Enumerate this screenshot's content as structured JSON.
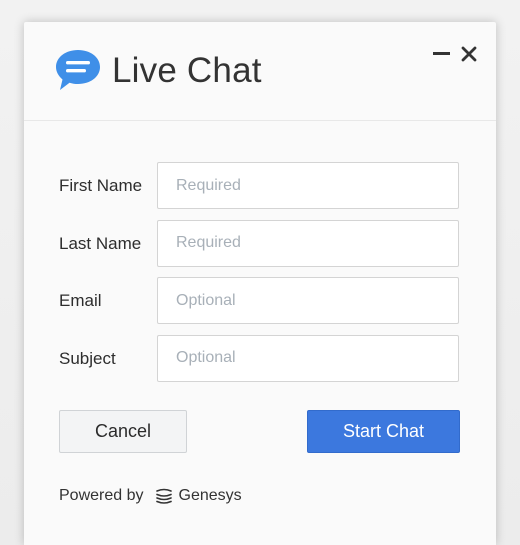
{
  "header": {
    "title": "Live Chat",
    "logo_icon": "chat-bubble-icon",
    "minimize_icon": "minimize-icon",
    "close_icon": "close-icon"
  },
  "form": {
    "fields": [
      {
        "label": "First Name",
        "placeholder": "Required",
        "value": ""
      },
      {
        "label": "Last Name",
        "placeholder": "Required",
        "value": ""
      },
      {
        "label": "Email",
        "placeholder": "Optional",
        "value": ""
      },
      {
        "label": "Subject",
        "placeholder": "Optional",
        "value": ""
      }
    ]
  },
  "actions": {
    "cancel_label": "Cancel",
    "start_label": "Start Chat"
  },
  "footer": {
    "powered_by": "Powered by",
    "brand": "Genesys",
    "brand_icon": "genesys-logo-icon"
  },
  "colors": {
    "accent": "#3c78de",
    "logo_blue": "#3f8fe8",
    "text": "#333333",
    "placeholder": "#a8b0b8"
  }
}
